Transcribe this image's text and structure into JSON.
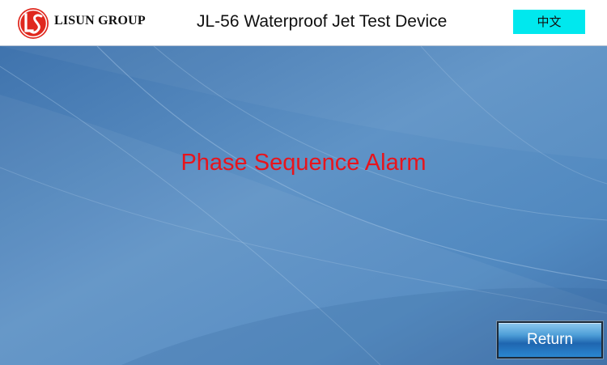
{
  "header": {
    "company_name": "LISUN GROUP",
    "device_title": "JL-56 Waterproof Jet Test Device",
    "language_button_label": "中文"
  },
  "main": {
    "alarm_message": "Phase Sequence Alarm",
    "return_button_label": "Return"
  },
  "colors": {
    "alarm_text": "#e8141c",
    "language_button_bg": "#00e8ee",
    "logo_red": "#e0281e",
    "background_blue": "#4f82b8"
  },
  "icons": {
    "logo": "lisun-logo-icon"
  }
}
